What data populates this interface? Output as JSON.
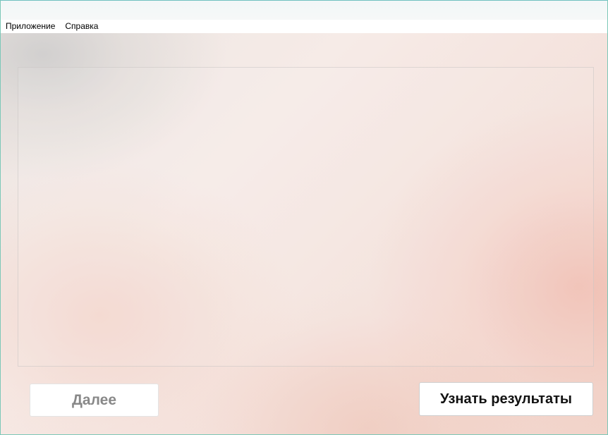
{
  "menu": {
    "items": [
      {
        "label": "Приложение"
      },
      {
        "label": "Справка"
      }
    ]
  },
  "buttons": {
    "next_label": "Далее",
    "results_label": "Узнать результаты",
    "next_enabled": false,
    "results_enabled": true
  },
  "colors": {
    "window_border": "#7cc8b8",
    "disabled_text": "#888888",
    "button_background": "#ffffff"
  }
}
